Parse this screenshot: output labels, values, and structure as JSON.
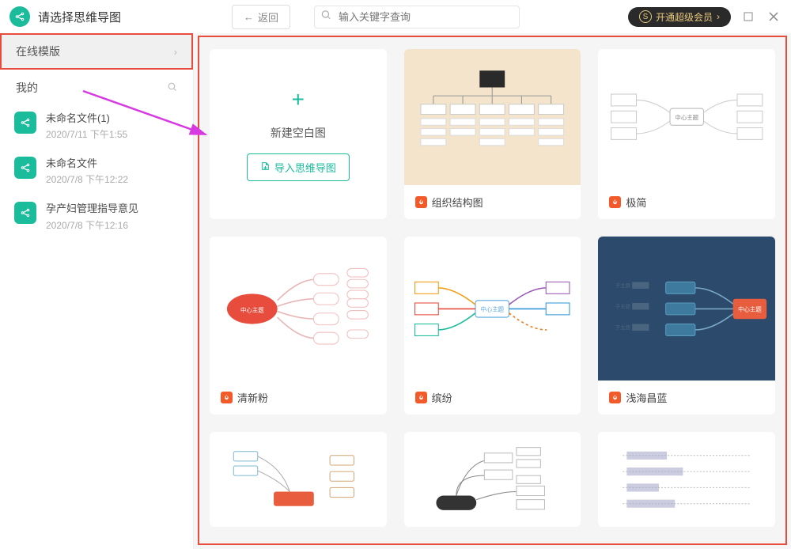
{
  "header": {
    "title": "请选择思维导图",
    "back_label": "返回",
    "search_placeholder": "输入关键字查询",
    "vip_label": "开通超级会员"
  },
  "sidebar": {
    "online_templates": "在线模版",
    "my_label": "我的",
    "files": [
      {
        "name": "未命名文件(1)",
        "time": "2020/7/11 下午1:55"
      },
      {
        "name": "未命名文件",
        "time": "2020/7/8 下午12:22"
      },
      {
        "name": "孕产妇管理指导意见",
        "time": "2020/7/8 下午12:16"
      }
    ]
  },
  "main": {
    "create_label": "新建空白图",
    "import_label": "导入思维导图",
    "templates": [
      {
        "label": "组织结构图"
      },
      {
        "label": "极简"
      },
      {
        "label": "清新粉"
      },
      {
        "label": "缤纷"
      },
      {
        "label": "浅海昌蓝"
      }
    ]
  },
  "colors": {
    "accent": "#1abc9c",
    "highlight": "#e74c3c",
    "hot": "#f25a29"
  }
}
